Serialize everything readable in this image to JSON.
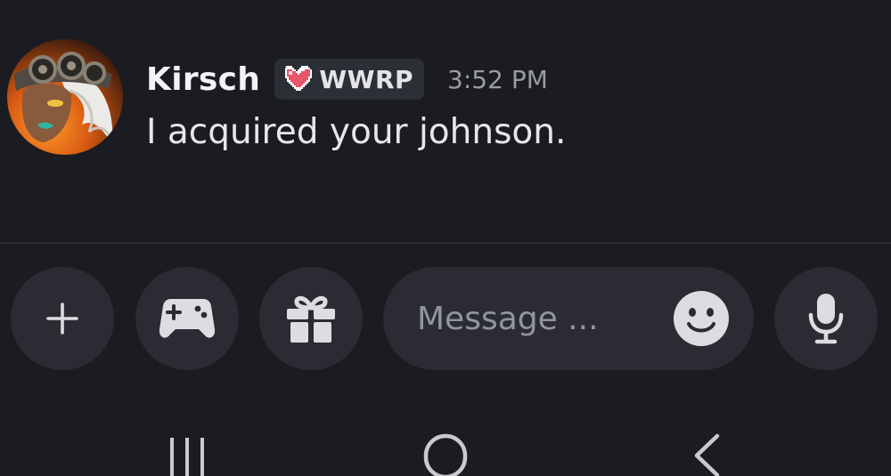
{
  "message": {
    "author": "Kirsch",
    "tag": "WWRP",
    "tag_icon": "pixel-heart-icon",
    "timestamp": "3:52 PM",
    "content": "I acquired your johnson."
  },
  "composer": {
    "placeholder": "Message ...",
    "buttons": [
      "plus-icon",
      "gamepad-icon",
      "gift-icon",
      "emoji-icon",
      "microphone-icon"
    ]
  },
  "system_nav": {
    "buttons": [
      "recents-icon",
      "home-icon",
      "back-icon"
    ]
  },
  "colors": {
    "background": "#1b1c21",
    "surface": "#2b2c33",
    "icon": "#dcdde1",
    "text_primary": "#f2f3f5",
    "text_muted": "#9a9ca4",
    "heart": "#e8556a"
  }
}
